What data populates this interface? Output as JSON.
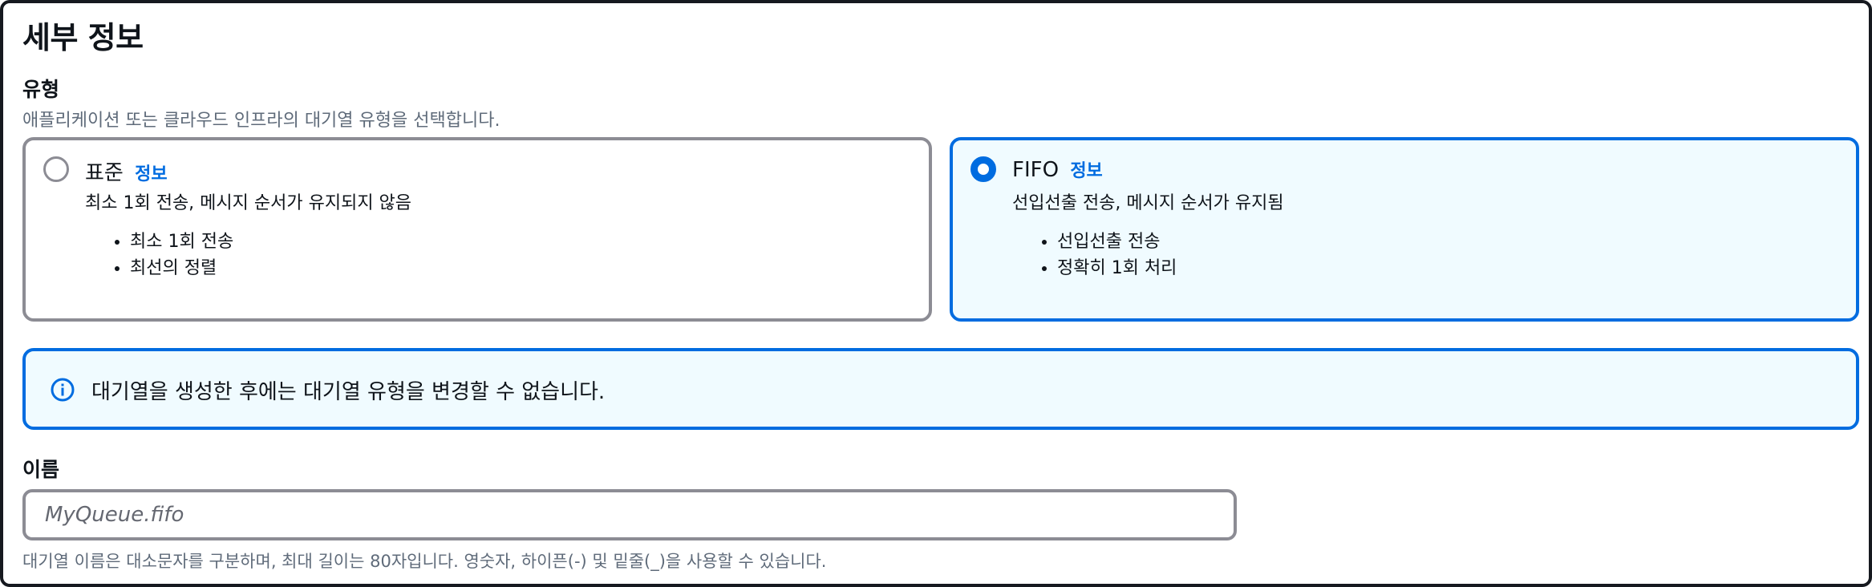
{
  "section": {
    "title": "세부 정보"
  },
  "type": {
    "label": "유형",
    "description": "애플리케이션 또는 클라우드 인프라의 대기열 유형을 선택합니다.",
    "options": [
      {
        "title": "표준",
        "info": "정보",
        "subtitle": "최소 1회 전송, 메시지 순서가 유지되지 않음",
        "bullets": [
          "최소 1회 전송",
          "최선의 정렬"
        ],
        "selected": false
      },
      {
        "title": "FIFO",
        "info": "정보",
        "subtitle": "선입선출 전송, 메시지 순서가 유지됨",
        "bullets": [
          "선입선출 전송",
          "정확히 1회 처리"
        ],
        "selected": true
      }
    ]
  },
  "alert": {
    "text": "대기열을 생성한 후에는 대기열 유형을 변경할 수 없습니다."
  },
  "name": {
    "label": "이름",
    "placeholder": "MyQueue.fifo",
    "value": "",
    "hint": "대기열 이름은 대소문자를 구분하며, 최대 길이는 80자입니다. 영숫자, 하이픈(-) 및 밑줄(_)을 사용할 수 있습니다."
  },
  "colors": {
    "accent": "#006ce0",
    "selected_bg": "#f0fbff",
    "border": "#8c8c94",
    "muted_text": "#5f6b7a"
  },
  "icons": {
    "alert_icon": "info-circle-icon"
  }
}
